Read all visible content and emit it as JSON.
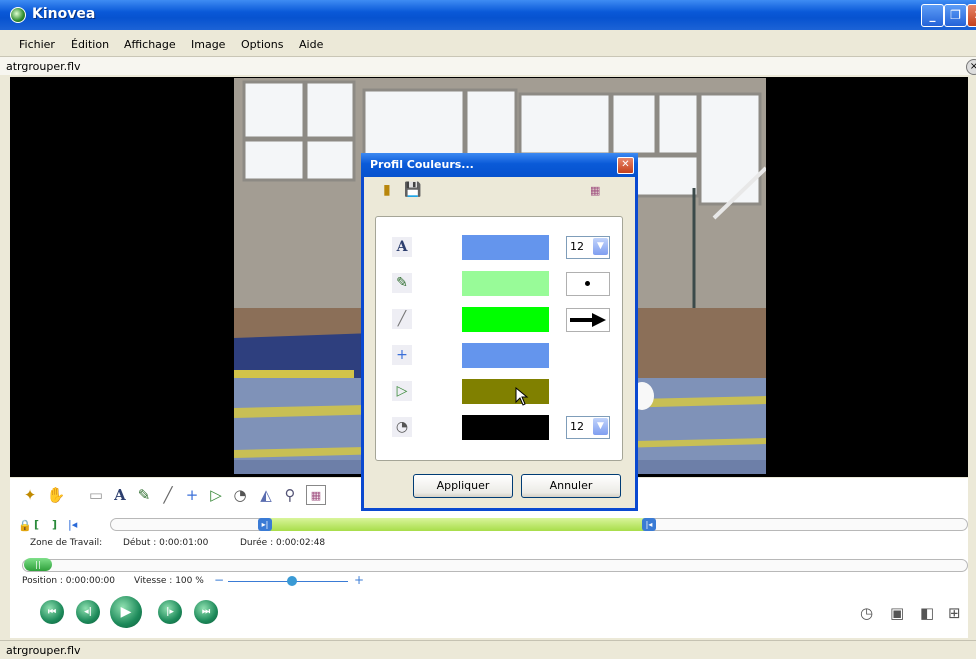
{
  "window": {
    "title": "Kinovea"
  },
  "menu": [
    "Fichier",
    "Édition",
    "Affichage",
    "Image",
    "Options",
    "Aide"
  ],
  "file_tab": {
    "name": "atrgrouper.flv"
  },
  "timeline": {
    "zone_label": "Zone de Travail:",
    "debut": "Début : 0:00:01:00",
    "duree": "Durée : 0:00:02:48",
    "position": "Position : 0:00:00:00",
    "vitesse": "Vitesse : 100 %"
  },
  "status_bar": {
    "text": "atrgrouper.flv"
  },
  "dialog": {
    "title": "Profil Couleurs...",
    "rows": [
      {
        "tool": "text-tool",
        "color": "#6495ed",
        "option": "12"
      },
      {
        "tool": "pencil-tool",
        "color": "#98fb98"
      },
      {
        "tool": "line-tool",
        "color": "#00ff00"
      },
      {
        "tool": "cross-tool",
        "color": "#6495ed"
      },
      {
        "tool": "angle-tool",
        "color": "#808000"
      },
      {
        "tool": "chrono-tool",
        "color": "#000000",
        "option": "12"
      }
    ],
    "apply_label": "Appliquer",
    "cancel_label": "Annuler"
  }
}
